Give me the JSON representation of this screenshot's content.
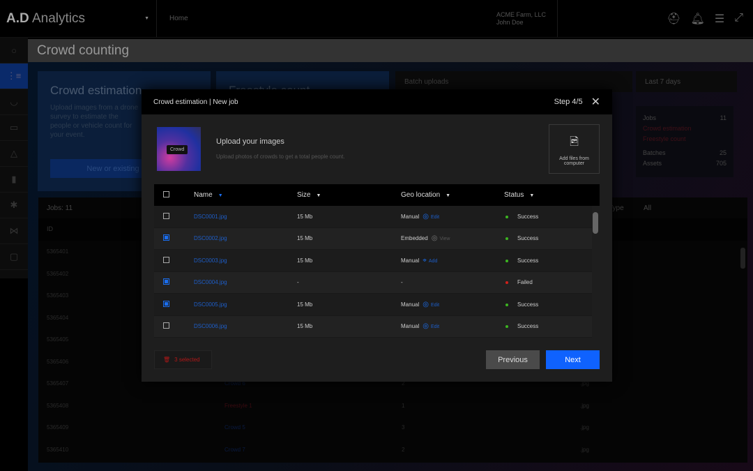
{
  "topbar": {
    "logo_bold": "A.D",
    "logo_light": " Analytics",
    "home": "Home",
    "org": "ACME Farm, LLC",
    "user": "John Doe"
  },
  "page": {
    "title": "Crowd counting"
  },
  "background": {
    "crowd_card": {
      "title": "Crowd estimation",
      "desc": "Upload images from a drone survey to estimate the people or vehicle count for your event.",
      "button": "New or existing"
    },
    "freestyle_card": {
      "title": "Freestyle count"
    },
    "batch": "Batch uploads",
    "range": "Last 7 days",
    "stats": [
      {
        "label": "Jobs",
        "value": "11"
      },
      {
        "label": "Crowd estimation",
        "value": ""
      },
      {
        "label": "Freestyle count",
        "value": ""
      },
      {
        "label": "Batches",
        "value": "25"
      },
      {
        "label": "Assets",
        "value": "705"
      }
    ],
    "jobs_label": "Jobs: 11",
    "type_label": "Type",
    "type_value": "All",
    "id_header": "ID",
    "rows": [
      {
        "id": "5365401"
      },
      {
        "id": "5365402"
      },
      {
        "id": "5365403"
      },
      {
        "id": "5365404"
      },
      {
        "id": "5365405"
      },
      {
        "id": "5365406"
      },
      {
        "id": "5365407",
        "name": "Crowd 6",
        "count": "2",
        "ext": ".jpg"
      },
      {
        "id": "5365408",
        "name": "Freestyle 1",
        "count": "1",
        "ext": ".jpg"
      },
      {
        "id": "5365409",
        "name": "Crowd 5",
        "count": "3",
        "ext": ".jpg"
      },
      {
        "id": "5365410",
        "name": "Crowd 7",
        "count": "2",
        "ext": ".jpg"
      }
    ]
  },
  "modal": {
    "title": "Crowd estimation | New job",
    "step": "Step 4/5",
    "thumb_label": "Crowd",
    "upload_title": "Upload your images",
    "upload_desc": "Upload photos of crowds to get a total people count.",
    "add_files": "Add files from computer",
    "columns": [
      "Name",
      "Size",
      "Geo location",
      "Status"
    ],
    "rows": [
      {
        "name": "DSC0001.jpg",
        "size": "15 Mb",
        "geo": "Manual",
        "action": "Edit",
        "status": "Success",
        "checked": false
      },
      {
        "name": "DSC0002.jpg",
        "size": "15 Mb",
        "geo": "Embedded",
        "action": "View",
        "status": "Success",
        "checked": true
      },
      {
        "name": "DSC0003.jpg",
        "size": "15 Mb",
        "geo": "Manual",
        "action": "Add",
        "status": "Success",
        "checked": false
      },
      {
        "name": "DSC0004.jpg",
        "size": "-",
        "geo": "-",
        "action": "",
        "status": "Failed",
        "checked": true
      },
      {
        "name": "DSC0005.jpg",
        "size": "15 Mb",
        "geo": "Manual",
        "action": "Edit",
        "status": "Success",
        "checked": true
      },
      {
        "name": "DSC0006.jpg",
        "size": "15 Mb",
        "geo": "Manual",
        "action": "Edit",
        "status": "Success",
        "checked": false
      }
    ],
    "selected": "3 selected",
    "previous": "Previous",
    "next": "Next"
  },
  "colors": {
    "accent": "#0f62fe",
    "success": "#3cb521",
    "failed": "#d0201a"
  }
}
